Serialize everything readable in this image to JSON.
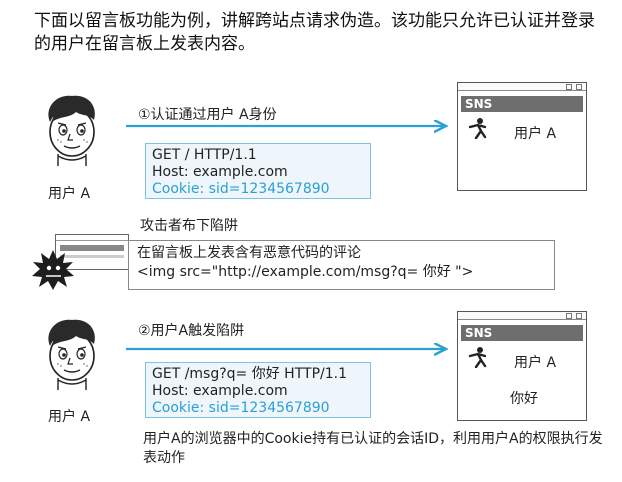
{
  "intro": "下面以留言板功能为例，讲解跨站点请求伪造。该功能只允许已认证并登录的用户在留言板上发表内容。",
  "user_label": "用户 A",
  "step1": "①认证通过用户 A身份",
  "request1": {
    "line1": "GET / HTTP/1.1",
    "line2": "Host: example.com",
    "cookie": "Cookie: sid=1234567890"
  },
  "browser1": {
    "site": "SNS",
    "user": "用户 A"
  },
  "attacker_caption": "攻击者布下陷阱",
  "attack": {
    "line1": "在留言板上发表含有恶意代码的评论",
    "line2": "<img src=\"http://example.com/msg?q= 你好 \">"
  },
  "step2": "②用户A触发陷阱",
  "request2": {
    "line1": "GET /msg?q= 你好 HTTP/1.1",
    "line2": "Host: example.com",
    "cookie": "Cookie: sid=1234567890"
  },
  "browser2": {
    "site": "SNS",
    "user": "用户 A",
    "post": "你好"
  },
  "footer": "用户A的浏览器中的Cookie持有已认证的会话ID，利用用户A的权限执行发表动作",
  "colors": {
    "arrow": "#2aa0d4",
    "cookie": "#2aa0d4",
    "request_bg": "#eef6fb",
    "sns_bar": "#6e6e6e"
  }
}
